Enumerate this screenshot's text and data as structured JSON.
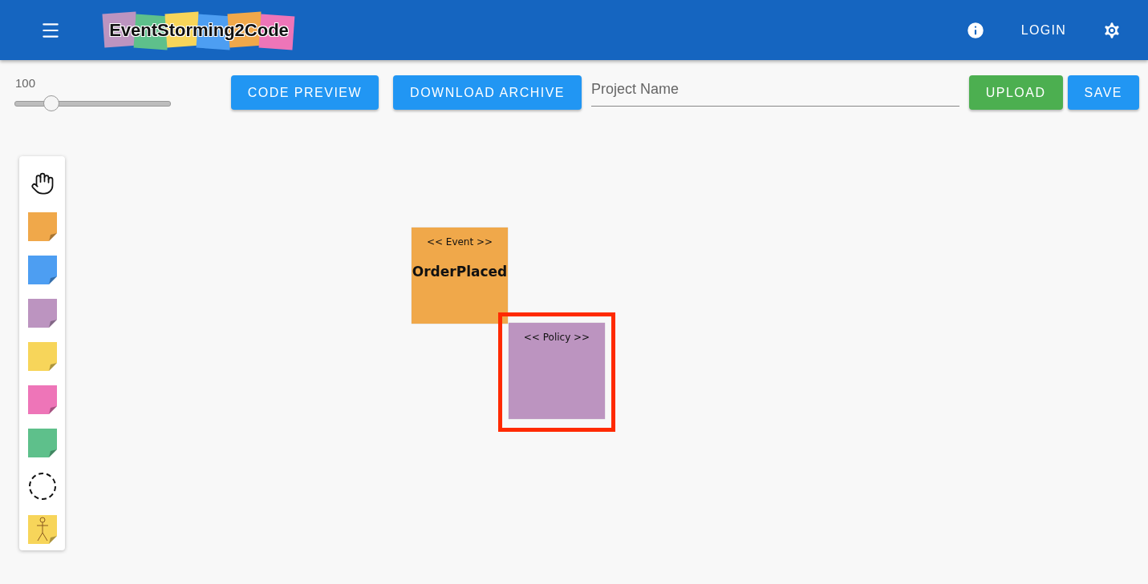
{
  "header": {
    "logo_text": "EventStorming2Code",
    "login": "LOGIN"
  },
  "zoom": {
    "value": "100",
    "level": 0.23
  },
  "toolbar": {
    "buttons": [
      {
        "label": "CODE PREVIEW"
      },
      {
        "label": "DOWNLOAD ARCHIVE"
      }
    ],
    "project_name": {
      "placeholder": "Project Name"
    },
    "actions": [
      {
        "label": "UPLOAD",
        "kind": "success"
      },
      {
        "label": "SAVE",
        "kind": "primary"
      }
    ]
  },
  "palette": [
    {
      "kind": "hand"
    },
    {
      "kind": "sticky",
      "color": "#f0a84a"
    },
    {
      "kind": "sticky",
      "color": "#4d9ef2"
    },
    {
      "kind": "sticky",
      "color": "#bc94c0"
    },
    {
      "kind": "sticky",
      "color": "#f7d55a"
    },
    {
      "kind": "sticky",
      "color": "#ee75b8"
    },
    {
      "kind": "sticky",
      "color": "#5ec08b"
    },
    {
      "kind": "boundary"
    },
    {
      "kind": "actor",
      "color": "#f7d55a"
    }
  ],
  "canvas": {
    "stickies": [
      {
        "stereotype": "<< Event >>",
        "name": "OrderPlaced",
        "color": "#f0a84a",
        "selected": false
      },
      {
        "stereotype": "<< Policy >>",
        "color": "#bc94c0",
        "selected": true
      }
    ]
  }
}
